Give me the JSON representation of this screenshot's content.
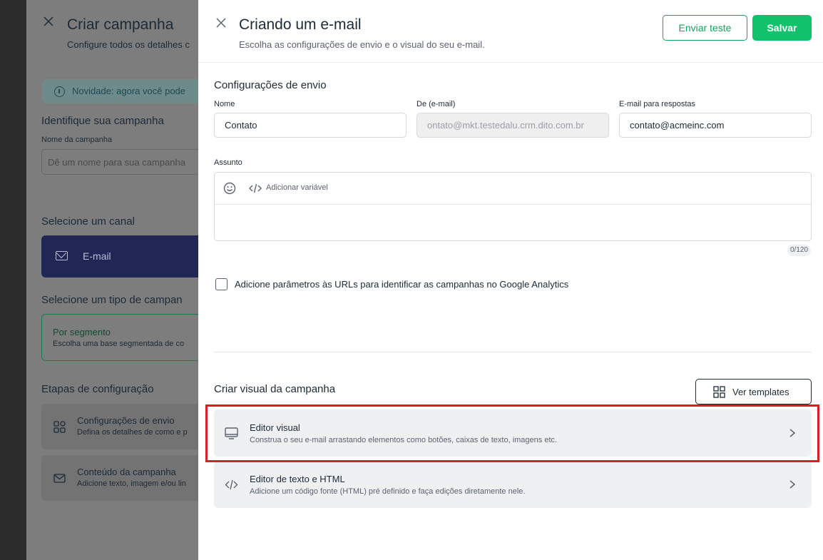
{
  "background_panel": {
    "title": "Criar campanha",
    "subtitle": "Configure todos os detalhes c",
    "novidade": "Novidade: agora você pode",
    "identify_heading": "Identifique sua campanha",
    "name_label": "Nome da campanha",
    "name_placeholder": "Dê um nome para sua campanha",
    "channel_heading": "Selecione um canal",
    "channel_email": "E-mail",
    "type_heading": "Selecione um tipo de campan",
    "segment_title": "Por segmento",
    "segment_desc": "Escolha uma base segmentada de co",
    "steps_heading": "Etapas de configuração",
    "steps": [
      {
        "title": "Configurações de envio",
        "desc": "Defina os detalhes de como e p"
      },
      {
        "title": "Conteúdo da campanha",
        "desc": "Adicione texto, imagem e/ou lin"
      }
    ]
  },
  "drawer": {
    "title": "Criando um e-mail",
    "subtitle": "Escolha as configurações de envio e o visual do seu e-mail.",
    "send_test_label": "Enviar teste",
    "save_label": "Salvar"
  },
  "send_settings": {
    "heading": "Configurações de envio",
    "name_label": "Nome",
    "name_value": "Contato",
    "from_label": "De (e-mail)",
    "from_value": "ontato@mkt.testedalu.crm.dito.com.br",
    "reply_label": "E-mail para respostas",
    "reply_value": "contato@acmeinc.com",
    "subject_label": "Assunto",
    "add_variable_label": "Adicionar variável",
    "subject_value": "",
    "counter": "0/120",
    "analytics_label": "Adicione parâmetros às URLs para identificar as campanhas no Google Analytics"
  },
  "visual": {
    "heading": "Criar visual da campanha",
    "templates_label": "Ver templates",
    "options": [
      {
        "title": "Editor visual",
        "desc": "Construa o seu e-mail arrastando elementos como botões, caixas de texto, imagens etc."
      },
      {
        "title": "Editor de texto e HTML",
        "desc": "Adicione um código fonte (HTML) pré definido e faça edições diretamente nele."
      }
    ]
  },
  "colors": {
    "accent_green": "#12c26a",
    "outline_green": "#16a35c",
    "text_dark": "#1c2a38",
    "highlight_red": "#d62026",
    "email_channel": "#222654"
  }
}
